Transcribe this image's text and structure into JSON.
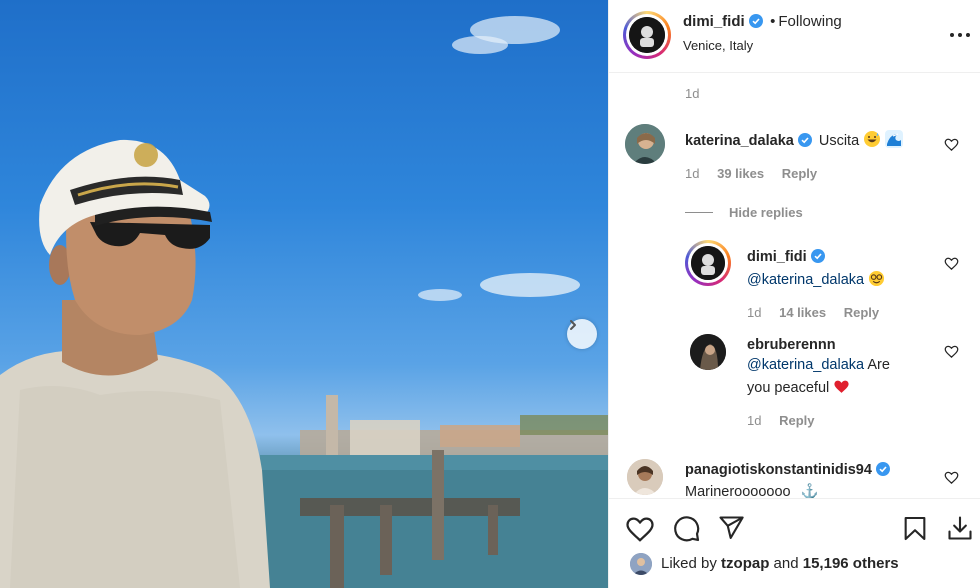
{
  "post": {
    "author": "dimi_fidi",
    "following_label": "Following",
    "separator": "•",
    "location": "Venice, Italy",
    "caption_time": "1d"
  },
  "comments": [
    {
      "user": "katerina_dalaka",
      "verified": true,
      "text": "Uscita",
      "emojis": [
        "grinning-sweat-emoji",
        "wave-emoji"
      ],
      "time": "1d",
      "likes": "39 likes",
      "reply": "Reply",
      "hide_replies": "Hide replies",
      "replies": [
        {
          "user": "dimi_fidi",
          "verified": true,
          "mention": "@katerina_dalaka",
          "text": "",
          "emojis": [
            "nerd-face-emoji"
          ],
          "time": "1d",
          "likes": "14 likes",
          "reply": "Reply"
        },
        {
          "user": "ebruberennn",
          "verified": false,
          "mention": "@katerina_dalaka",
          "text": "Are",
          "text2": "you peaceful",
          "emojis": [
            "red-heart-emoji"
          ],
          "time": "1d",
          "reply": "Reply"
        }
      ]
    },
    {
      "user": "panagiotiskonstantinidis94",
      "verified": true,
      "text": "Marinerooooooo",
      "emojis": [
        "anchor-emoji"
      ]
    }
  ],
  "actions": {
    "icons": [
      "heart-icon",
      "comment-icon",
      "share-icon",
      "bookmark-icon",
      "download-icon"
    ],
    "liked_prefix": "Liked by",
    "liked_user": "tzopap",
    "liked_and": "and",
    "liked_count": "15,196 others"
  },
  "colors": {
    "verified_blue": "#3897f0",
    "muted": "#8e8e8e",
    "text": "#262626",
    "mention": "#00376b",
    "heart_red": "#ed4956"
  }
}
